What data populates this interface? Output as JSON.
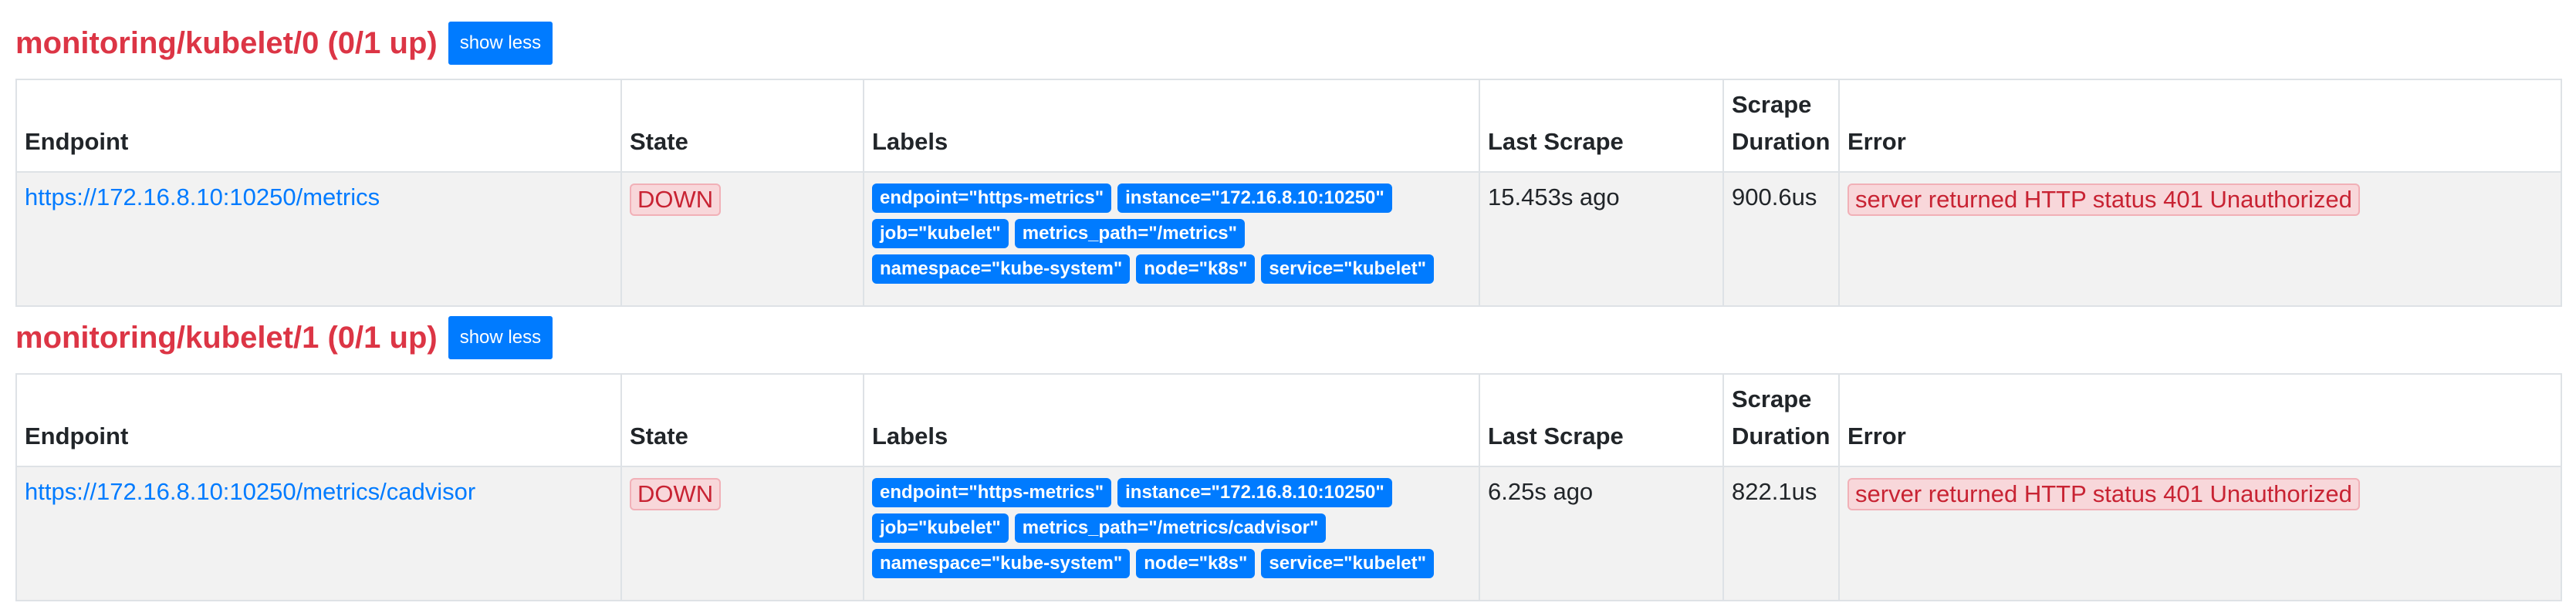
{
  "columns": {
    "endpoint": "Endpoint",
    "state": "State",
    "labels": "Labels",
    "last_scrape": "Last Scrape",
    "scrape_duration_line1": "Scrape",
    "scrape_duration_line2": "Duration",
    "error": "Error"
  },
  "jobs": [
    {
      "title": "monitoring/kubelet/0 (0/1 up)",
      "toggle_label": "show less",
      "target": {
        "endpoint": "https://172.16.8.10:10250/metrics",
        "state": "DOWN",
        "labels": [
          "endpoint=\"https-metrics\"",
          "instance=\"172.16.8.10:10250\"",
          "job=\"kubelet\"",
          "metrics_path=\"/metrics\"",
          "namespace=\"kube-system\"",
          "node=\"k8s\"",
          "service=\"kubelet\""
        ],
        "last_scrape": "15.453s ago",
        "scrape_duration": "900.6us",
        "error": "server returned HTTP status 401 Unauthorized"
      }
    },
    {
      "title": "monitoring/kubelet/1 (0/1 up)",
      "toggle_label": "show less",
      "target": {
        "endpoint": "https://172.16.8.10:10250/metrics/cadvisor",
        "state": "DOWN",
        "labels": [
          "endpoint=\"https-metrics\"",
          "instance=\"172.16.8.10:10250\"",
          "job=\"kubelet\"",
          "metrics_path=\"/metrics/cadvisor\"",
          "namespace=\"kube-system\"",
          "node=\"k8s\"",
          "service=\"kubelet\""
        ],
        "last_scrape": "6.25s ago",
        "scrape_duration": "822.1us",
        "error": "server returned HTTP status 401 Unauthorized"
      }
    }
  ]
}
